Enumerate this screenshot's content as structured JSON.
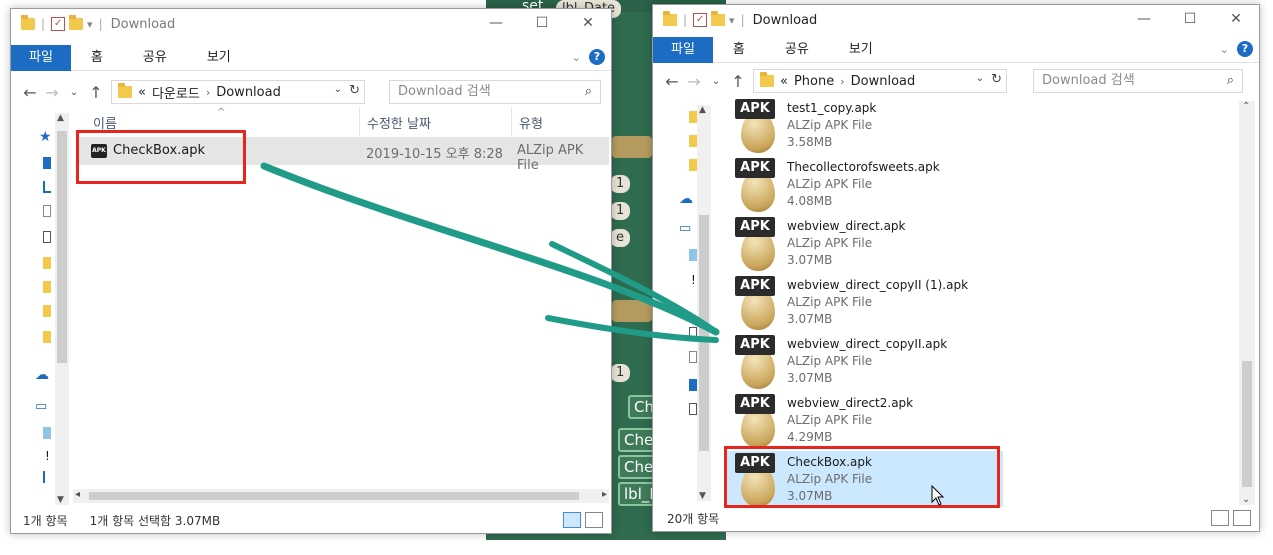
{
  "background_app": {
    "labels": [
      "set",
      "lbl_Date",
      "1",
      "1",
      "e",
      "1",
      "Ch",
      "Chec",
      "Chec",
      "lbl_M"
    ]
  },
  "left_window": {
    "title": "Download",
    "ribbon_tabs": [
      "파일",
      "홈",
      "공유",
      "보기"
    ],
    "breadcrumb": [
      "«",
      "다운로드",
      "Download"
    ],
    "search_placeholder": "Download 검색",
    "columns": [
      "이름",
      "수정한 날짜",
      "유형"
    ],
    "file": {
      "name": "CheckBox.apk",
      "date": "2019-10-15 오후 8:28",
      "type": "ALZip APK File",
      "icon": "apk-file-icon"
    },
    "status_count": "1개 항목",
    "status_selected": "1개 항목 선택함 3.07MB"
  },
  "right_window": {
    "title": "Download",
    "ribbon_tabs": [
      "파일",
      "홈",
      "공유",
      "보기"
    ],
    "breadcrumb": [
      "«",
      "Phone",
      "Download"
    ],
    "search_placeholder": "Download 검색",
    "files": [
      {
        "name": "test1_copy.apk",
        "type": "ALZip APK File",
        "size": "3.58MB",
        "tag": "APK"
      },
      {
        "name": "Thecollectorofsweets.apk",
        "type": "ALZip APK File",
        "size": "4.08MB",
        "tag": "APK"
      },
      {
        "name": "webview_direct.apk",
        "type": "ALZip APK File",
        "size": "3.07MB",
        "tag": "APK"
      },
      {
        "name": "webview_direct_copyII (1).apk",
        "type": "ALZip APK File",
        "size": "3.07MB",
        "tag": "APK"
      },
      {
        "name": "webview_direct_copyII.apk",
        "type": "ALZip APK File",
        "size": "3.07MB",
        "tag": "APK"
      },
      {
        "name": "webview_direct2.apk",
        "type": "ALZip APK File",
        "size": "4.29MB",
        "tag": "APK"
      },
      {
        "name": "CheckBox.apk",
        "type": "ALZip APK File",
        "size": "3.07MB",
        "tag": "APK"
      }
    ],
    "status_count": "20개 항목"
  },
  "colors": {
    "highlight_box": "#e8251c",
    "drag_arrow": "#1f9b87",
    "ribbon_file_tab": "#1c6cc4",
    "selection": "#cce8ff"
  }
}
